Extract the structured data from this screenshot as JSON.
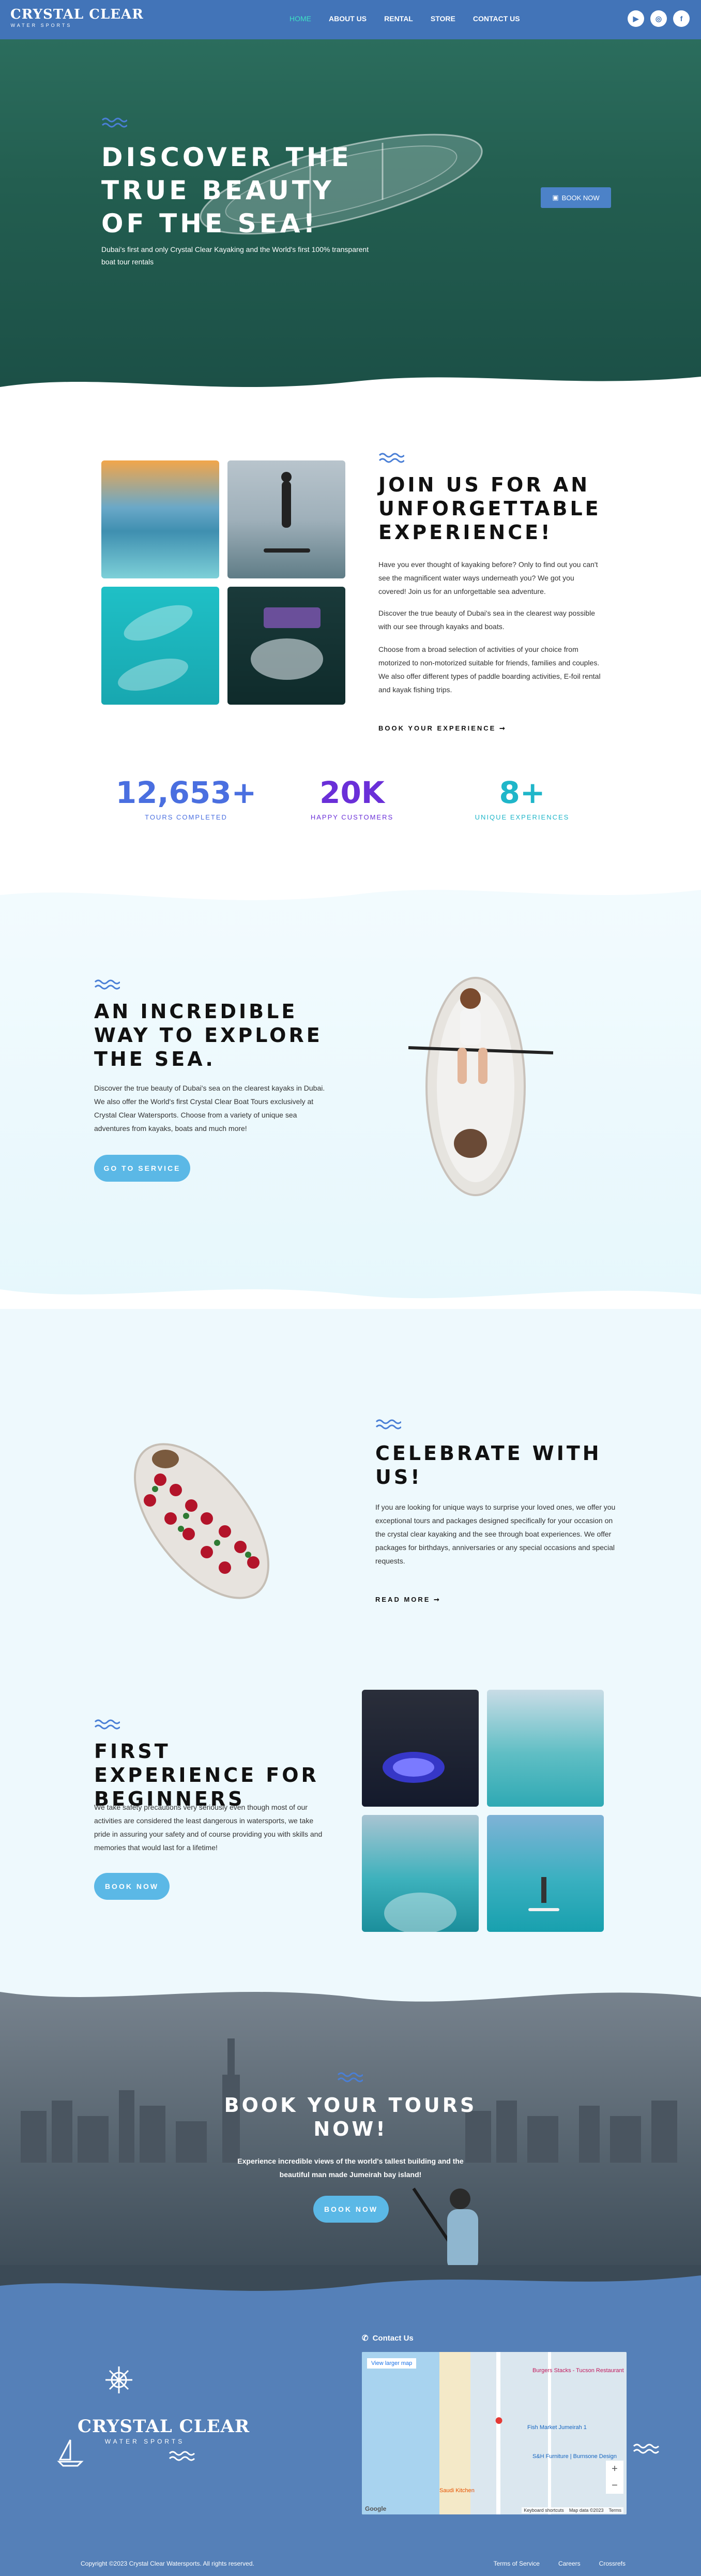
{
  "nav": {
    "logo_line1": "CRYSTAL CLEAR",
    "logo_line2": "WATER SPORTS",
    "items": [
      {
        "label": "HOME",
        "active": true
      },
      {
        "label": "ABOUT US"
      },
      {
        "label": "RENTAL"
      },
      {
        "label": "STORE"
      },
      {
        "label": "CONTACT US"
      }
    ],
    "socials": [
      "youtube-icon",
      "instagram-icon",
      "facebook-icon"
    ]
  },
  "hero": {
    "title": "DISCOVER THE TRUE BEAUTY OF THE SEA!",
    "subtitle": "Dubai's first and only Crystal Clear Kayaking and the World's first 100% transparent boat tour rentals",
    "book_label": "BOOK NOW"
  },
  "join": {
    "title": "JOIN US FOR AN UNFORGETTABLE EXPERIENCE!",
    "p1": "Have you ever thought of kayaking before? Only to find out you can't see the magnificent water ways underneath you? We got you covered! Join us for an unforgettable sea adventure.",
    "p2": "Discover the true beauty of Dubai's sea in the clearest way possible with our see through kayaks and boats.",
    "p3": "Choose from a broad selection of activities of your choice from motorized to non-motorized suitable for friends, families and couples. We also offer different types of paddle boarding activities, E-foil rental and kayak fishing trips.",
    "link": "BOOK YOUR EXPERIENCE ➞"
  },
  "stats": [
    {
      "value": "12,653+",
      "label": "TOURS COMPLETED",
      "color": "#4a6fe0"
    },
    {
      "value": "20K",
      "label": "HAPPY CUSTOMERS",
      "color": "#6a2fd8"
    },
    {
      "value": "8+",
      "label": "UNIQUE EXPERIENCES",
      "color": "#1fb6c9"
    }
  ],
  "explore": {
    "title": "AN INCREDIBLE WAY TO EXPLORE THE SEA.",
    "text": "Discover the true beauty of Dubai's sea on the clearest kayaks in Dubai. We also offer the World's first Crystal Clear Boat Tours exclusively at Crystal Clear Watersports. Choose from a variety of unique sea adventures from kayaks, boats and much more!",
    "button": "GO TO SERVICE"
  },
  "celebrate": {
    "title": "CELEBRATE WITH US!",
    "text": "If you are looking for unique ways to surprise your loved ones, we offer you exceptional tours and packages designed specifically for your occasion on the crystal clear kayaking and the see through boat experiences. We offer packages for birthdays, anniversaries or any special occasions and special requests.",
    "link": "READ MORE ➞"
  },
  "beginners": {
    "title": "FIRST EXPERIENCE FOR BEGINNERS",
    "text": "We take safety precautions very seriously even though most of our activities are considered the least dangerous in watersports, we take pride in assuring your safety and of course providing you with skills and memories that would last for a lifetime!",
    "button": "BOOK NOW"
  },
  "tours": {
    "title": "BOOK YOUR TOURS NOW!",
    "text": "Experience incredible views of the world's tallest building and the beautiful man made Jumeirah bay island!",
    "button": "BOOK NOW"
  },
  "footer": {
    "logo_line1": "CRYSTAL CLEAR",
    "logo_line2": "WATER SPORTS",
    "contact_label": "Contact Us",
    "map_link": "View larger map",
    "map_labels": [
      "Burgers Stacks - Tucson Restaurant",
      "Fish Market Jumeirah 1",
      "S&H Furniture | Burnsone Design",
      "Saudi Kitchen",
      "Keyboard shortcuts",
      "Map data ©2023",
      "Terms",
      "Google"
    ],
    "copyright": "Copyright ©2023 Crystal Clear Watersports. All rights reserved.",
    "links": [
      "Terms of Service",
      "Careers",
      "Crossrefs"
    ]
  }
}
